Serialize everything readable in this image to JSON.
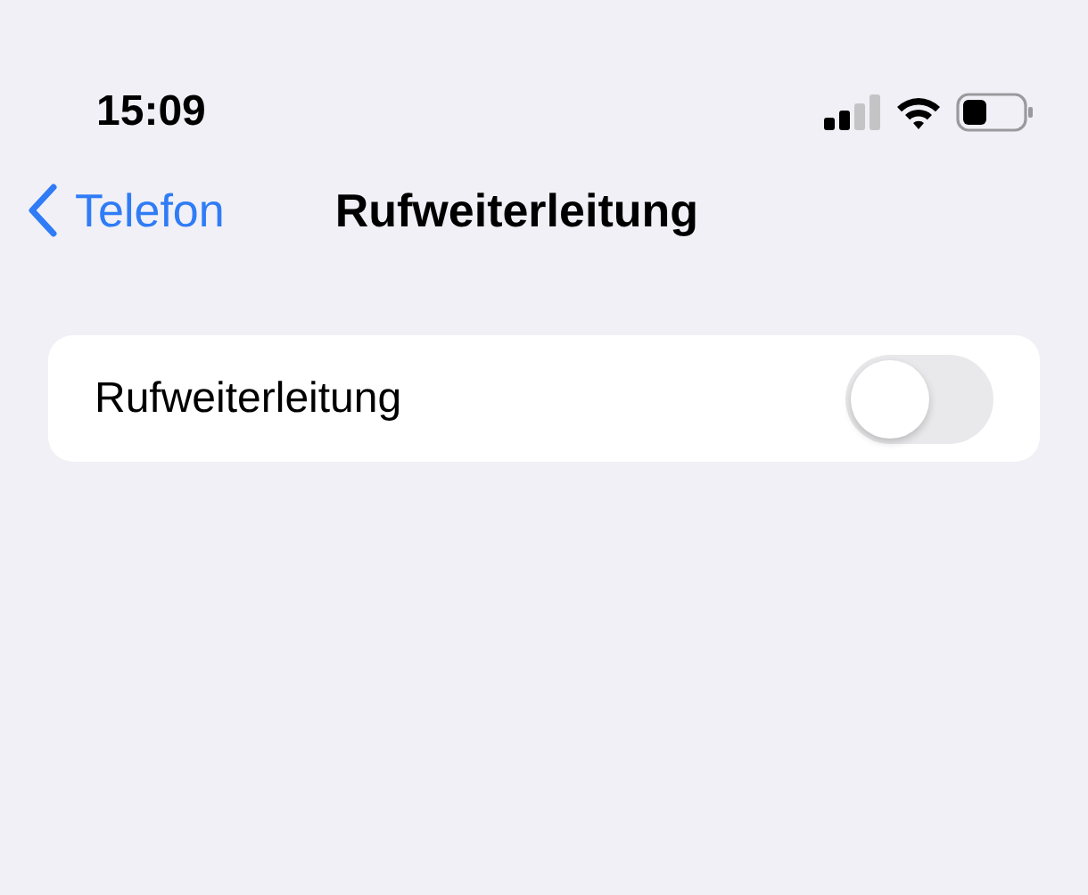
{
  "status_bar": {
    "time": "15:09"
  },
  "nav_bar": {
    "back_label": "Telefon",
    "title": "Rufweiterleitung"
  },
  "settings": [
    {
      "label": "Rufweiterleitung",
      "kind": "toggle",
      "on": false
    }
  ]
}
